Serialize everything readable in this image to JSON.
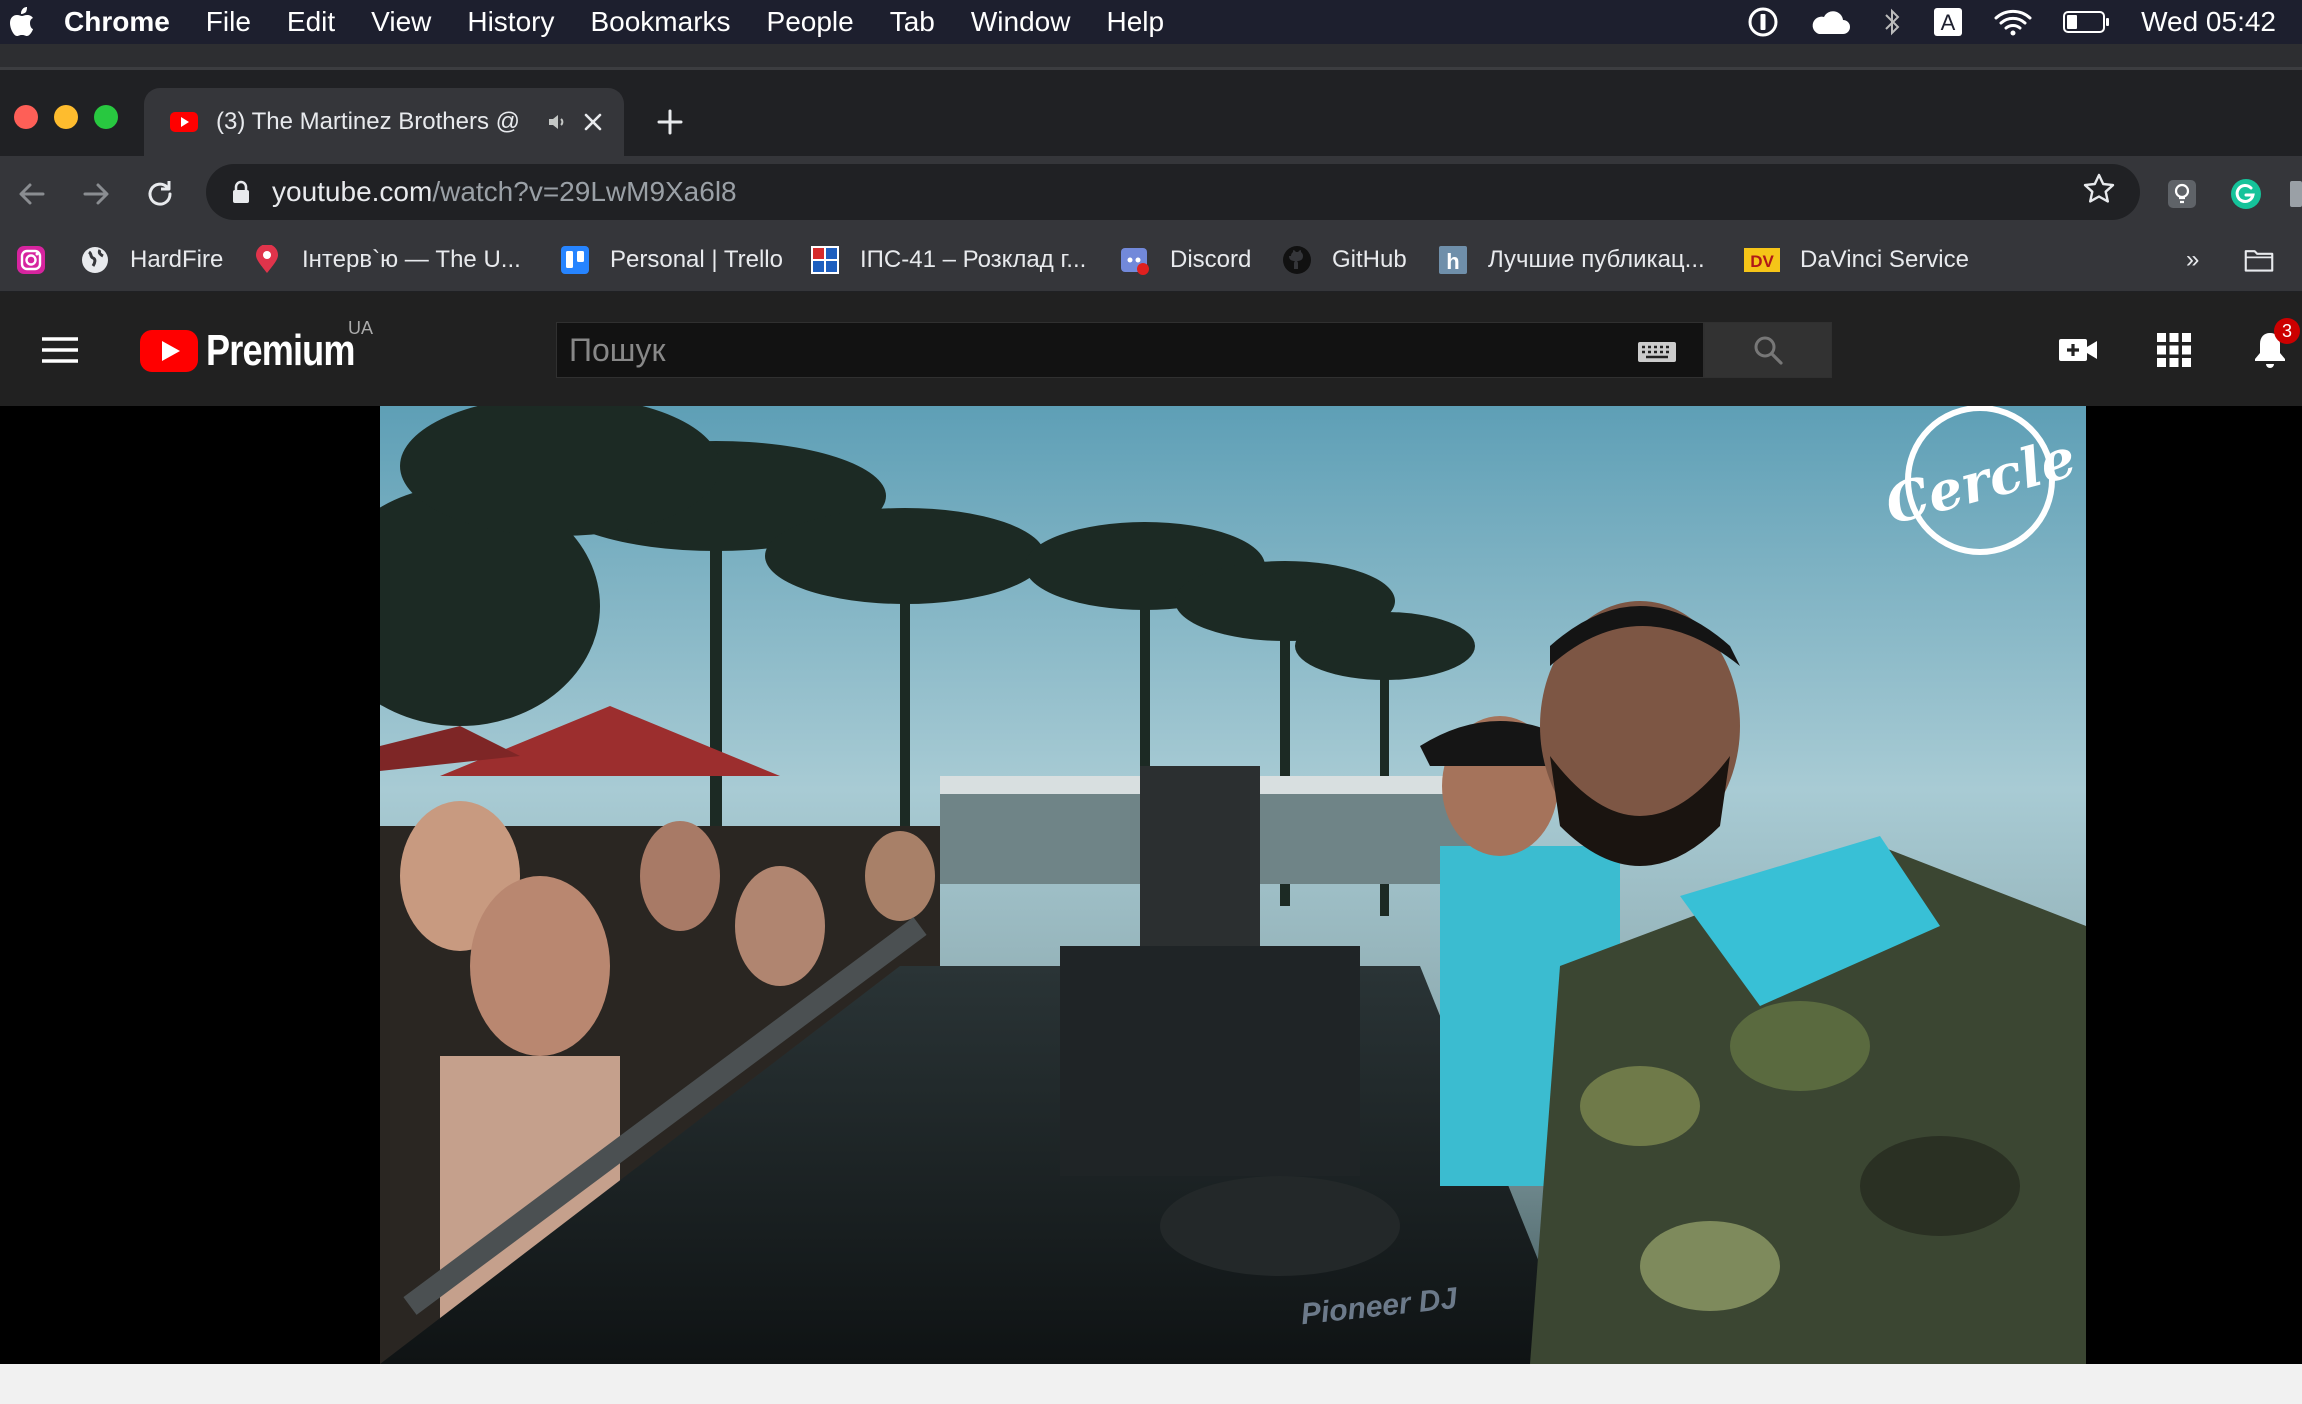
{
  "menubar": {
    "app": "Chrome",
    "items": [
      "File",
      "Edit",
      "View",
      "History",
      "Bookmarks",
      "People",
      "Tab",
      "Window",
      "Help"
    ],
    "clock": "Wed 05:42",
    "input_source": "A"
  },
  "tab": {
    "title": "(3) The Martinez Brothers @"
  },
  "omnibox": {
    "host": "youtube.com",
    "path": "/watch?v=29LwM9Xa6l8"
  },
  "bookmarks": [
    {
      "label": ""
    },
    {
      "label": "HardFire"
    },
    {
      "label": "Інтерв`ю — The U..."
    },
    {
      "label": "Personal | Trello"
    },
    {
      "label": "ІПС-41 – Розклад г..."
    },
    {
      "label": "Discord"
    },
    {
      "label": "GitHub"
    },
    {
      "label": "Лучшие публикац..."
    },
    {
      "label": "DaVinci Service"
    }
  ],
  "bookmarks_overflow": "»",
  "bookmark_icons": {
    "davinci": "DV",
    "habr": "h"
  },
  "youtube": {
    "brand": "Premium",
    "region": "UA",
    "search_placeholder": "Пошук",
    "notifications_count": "3"
  },
  "video": {
    "watermark": "Cercle",
    "deck_brand": "Pioneer DJ"
  },
  "colors": {
    "youtube_red": "#ff0000",
    "chrome_dark": "#202124",
    "toolbar": "#35363a",
    "yt_header": "#212121"
  }
}
